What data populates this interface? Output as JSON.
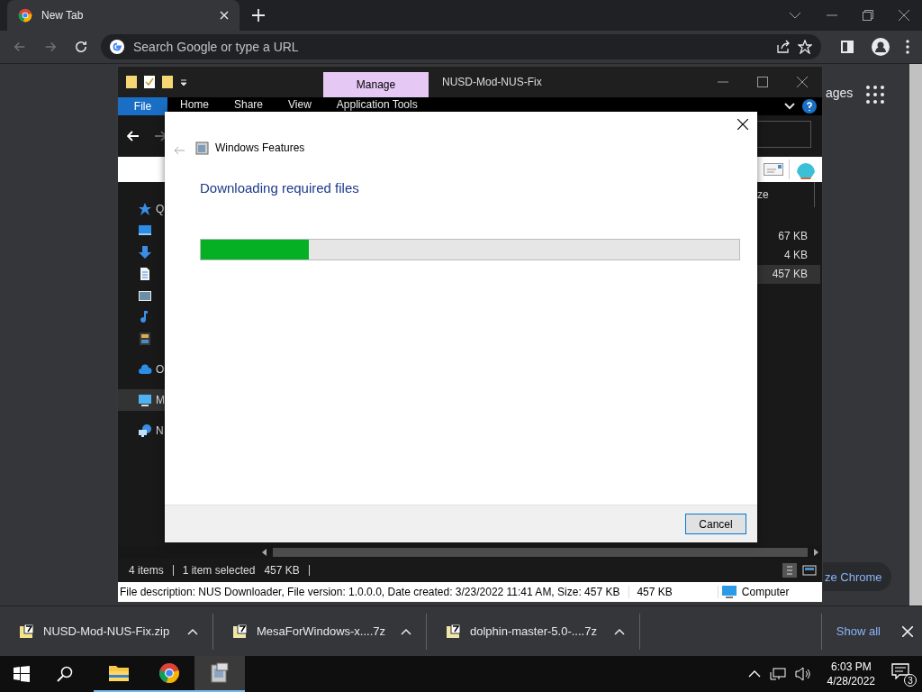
{
  "browser": {
    "tabs": [
      {
        "title": "New Tab",
        "selected": true
      }
    ],
    "nav": [
      {
        "kind": "back",
        "disabled": true
      },
      {
        "kind": "forward",
        "disabled": true
      },
      {
        "kind": "reload",
        "disabled": false
      }
    ],
    "omnibox": {
      "placeholder": "Search Google or type a URL"
    }
  },
  "page": {
    "images_link": "ages",
    "customize_button": "ze Chrome"
  },
  "explorer": {
    "title": "NUSD-Mod-NUS-Fix",
    "context_tab": "Manage",
    "file_tab": "File",
    "ribbon_tabs": [
      "Home",
      "Share",
      "View",
      "Application Tools"
    ],
    "nav_pane": [
      {
        "kind": "star",
        "label": "Q",
        "selected": false
      },
      {
        "kind": "desktop",
        "selected": false
      },
      {
        "kind": "download",
        "selected": false
      },
      {
        "kind": "document",
        "selected": false
      },
      {
        "kind": "image",
        "selected": false
      },
      {
        "kind": "music",
        "selected": false
      },
      {
        "kind": "video",
        "selected": false
      },
      {
        "kind": "cloud",
        "label": "O",
        "selected": false
      },
      {
        "kind": "computer",
        "label": "M",
        "selected": true
      },
      {
        "kind": "network",
        "label": "N",
        "selected": false
      }
    ],
    "column_header": "ze",
    "sizes": [
      {
        "text": "67 KB",
        "selected": false
      },
      {
        "text": "4 KB",
        "selected": false
      },
      {
        "text": "457 KB",
        "selected": true
      }
    ],
    "status": {
      "item_count": "4 items",
      "selection": "1 item selected",
      "selection_size": "457 KB"
    },
    "details": {
      "description": "File description: NUS Downloader, File version: 1.0.0.0, Date created: 3/23/2022 11:41 AM, Size: 457 KB",
      "size": "457 KB",
      "location": "Computer"
    }
  },
  "dialog": {
    "title": "Windows Features",
    "heading": "Downloading required files",
    "progress": {
      "level": 0.2
    },
    "cancel": "Cancel"
  },
  "downloads": {
    "items": [
      {
        "name": "NUSD-Mod-NUS-Fix.zip",
        "kind": "zip"
      },
      {
        "name": "MesaForWindows-x....7z",
        "kind": "sevenzip"
      },
      {
        "name": "dolphin-master-5.0-....7z",
        "kind": "sevenzip"
      }
    ],
    "show_all": "Show all"
  },
  "taskbar": {
    "apps": [
      {
        "kind": "explorer",
        "active": false
      },
      {
        "kind": "chrome",
        "active": false
      },
      {
        "kind": "features",
        "active": true
      }
    ],
    "time": "6:03 PM",
    "date": "4/28/2022",
    "notifications": "3"
  }
}
